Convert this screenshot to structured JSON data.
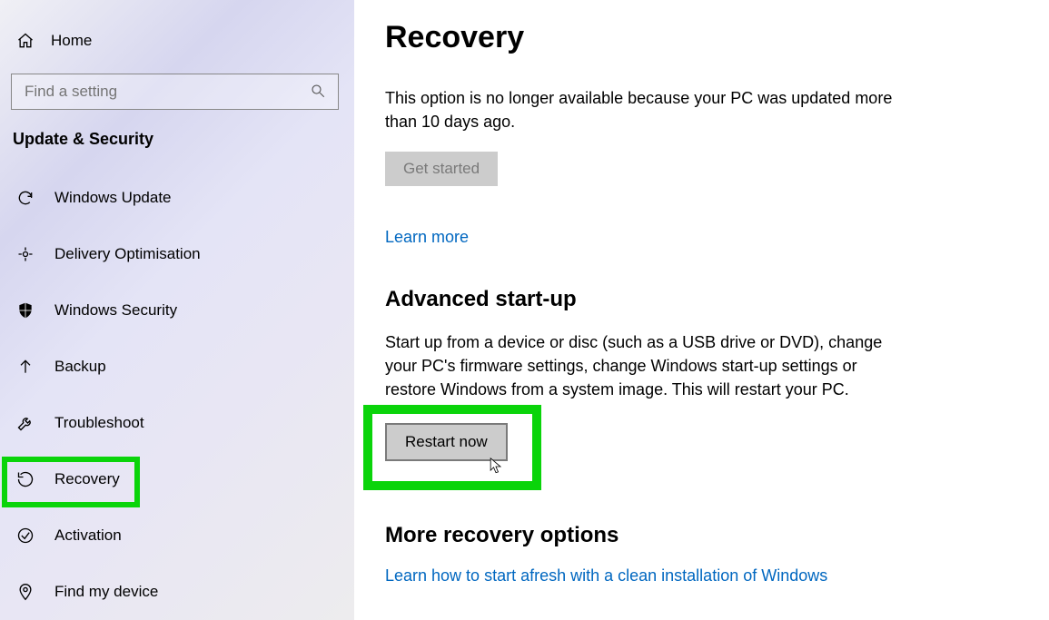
{
  "sidebar": {
    "home_label": "Home",
    "search_placeholder": "Find a setting",
    "category": "Update & Security",
    "items": [
      {
        "label": "Windows Update"
      },
      {
        "label": "Delivery Optimisation"
      },
      {
        "label": "Windows Security"
      },
      {
        "label": "Backup"
      },
      {
        "label": "Troubleshoot"
      },
      {
        "label": "Recovery"
      },
      {
        "label": "Activation"
      },
      {
        "label": "Find my device"
      }
    ]
  },
  "main": {
    "title": "Recovery",
    "reset_desc": "This option is no longer available because your PC was updated more than 10 days ago.",
    "get_started": "Get started",
    "learn_more": "Learn more",
    "adv_title": "Advanced start-up",
    "adv_desc": "Start up from a device or disc (such as a USB drive or DVD), change your PC's firmware settings, change Windows start-up settings or restore Windows from a system image. This will restart your PC.",
    "restart_now": "Restart now",
    "more_title": "More recovery options",
    "more_link": "Learn how to start afresh with a clean installation of Windows"
  }
}
